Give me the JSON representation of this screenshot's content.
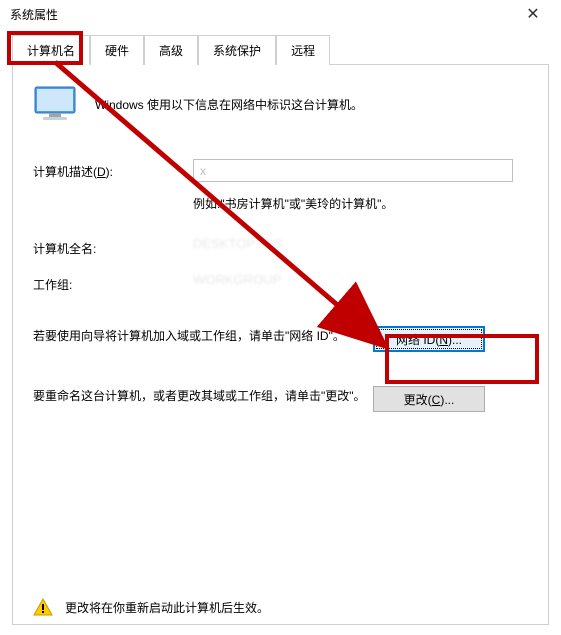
{
  "window": {
    "title": "系统属性",
    "close_label": "✕"
  },
  "tabs": {
    "items": [
      {
        "label": "计算机名",
        "active": true
      },
      {
        "label": "硬件",
        "active": false
      },
      {
        "label": "高级",
        "active": false
      },
      {
        "label": "系统保护",
        "active": false
      },
      {
        "label": "远程",
        "active": false
      }
    ]
  },
  "intro": {
    "text": "Windows 使用以下信息在网络中标识这台计算机。"
  },
  "fields": {
    "description": {
      "label_pre": "计算机描述(",
      "accel": "D",
      "label_post": "):",
      "value": "x"
    },
    "hint": "例如:\"书房计算机\"或\"美玲的计算机\"。",
    "full_name": {
      "label": "计算机全名:",
      "value": "DESKTOP JDS"
    },
    "workgroup": {
      "label": "工作组:",
      "value": "WORKGROUP"
    }
  },
  "actions": {
    "network_id": {
      "text": "若要使用向导将计算机加入域或工作组，请单击\"网络 ID\"。",
      "button_pre": "网络 ID(",
      "button_accel": "N",
      "button_post": ")..."
    },
    "change": {
      "text": "要重命名这台计算机，或者更改其域或工作组，请单击\"更改\"。",
      "button_pre": "更改(",
      "button_accel": "C",
      "button_post": ")..."
    }
  },
  "notice": {
    "text": "更改将在你重新启动此计算机后生效。"
  },
  "annotations": {
    "arrow_color": "#c00000"
  }
}
